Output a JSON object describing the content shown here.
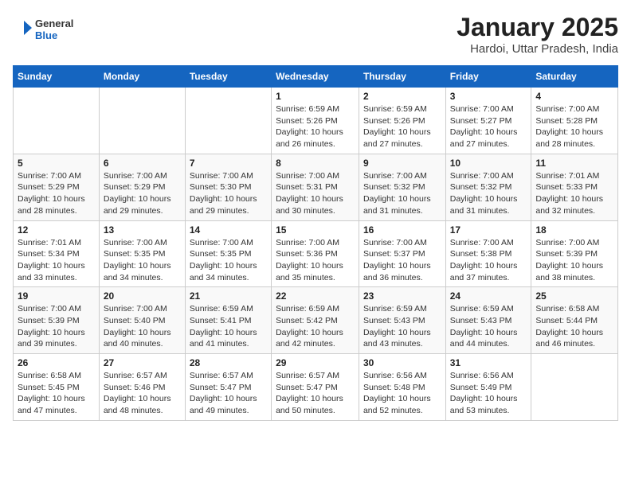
{
  "header": {
    "logo_line1": "General",
    "logo_line2": "Blue",
    "title": "January 2025",
    "subtitle": "Hardoi, Uttar Pradesh, India"
  },
  "days_of_week": [
    "Sunday",
    "Monday",
    "Tuesday",
    "Wednesday",
    "Thursday",
    "Friday",
    "Saturday"
  ],
  "weeks": [
    [
      {
        "num": "",
        "info": ""
      },
      {
        "num": "",
        "info": ""
      },
      {
        "num": "",
        "info": ""
      },
      {
        "num": "1",
        "info": "Sunrise: 6:59 AM\nSunset: 5:26 PM\nDaylight: 10 hours\nand 26 minutes."
      },
      {
        "num": "2",
        "info": "Sunrise: 6:59 AM\nSunset: 5:26 PM\nDaylight: 10 hours\nand 27 minutes."
      },
      {
        "num": "3",
        "info": "Sunrise: 7:00 AM\nSunset: 5:27 PM\nDaylight: 10 hours\nand 27 minutes."
      },
      {
        "num": "4",
        "info": "Sunrise: 7:00 AM\nSunset: 5:28 PM\nDaylight: 10 hours\nand 28 minutes."
      }
    ],
    [
      {
        "num": "5",
        "info": "Sunrise: 7:00 AM\nSunset: 5:29 PM\nDaylight: 10 hours\nand 28 minutes."
      },
      {
        "num": "6",
        "info": "Sunrise: 7:00 AM\nSunset: 5:29 PM\nDaylight: 10 hours\nand 29 minutes."
      },
      {
        "num": "7",
        "info": "Sunrise: 7:00 AM\nSunset: 5:30 PM\nDaylight: 10 hours\nand 29 minutes."
      },
      {
        "num": "8",
        "info": "Sunrise: 7:00 AM\nSunset: 5:31 PM\nDaylight: 10 hours\nand 30 minutes."
      },
      {
        "num": "9",
        "info": "Sunrise: 7:00 AM\nSunset: 5:32 PM\nDaylight: 10 hours\nand 31 minutes."
      },
      {
        "num": "10",
        "info": "Sunrise: 7:00 AM\nSunset: 5:32 PM\nDaylight: 10 hours\nand 31 minutes."
      },
      {
        "num": "11",
        "info": "Sunrise: 7:01 AM\nSunset: 5:33 PM\nDaylight: 10 hours\nand 32 minutes."
      }
    ],
    [
      {
        "num": "12",
        "info": "Sunrise: 7:01 AM\nSunset: 5:34 PM\nDaylight: 10 hours\nand 33 minutes."
      },
      {
        "num": "13",
        "info": "Sunrise: 7:00 AM\nSunset: 5:35 PM\nDaylight: 10 hours\nand 34 minutes."
      },
      {
        "num": "14",
        "info": "Sunrise: 7:00 AM\nSunset: 5:35 PM\nDaylight: 10 hours\nand 34 minutes."
      },
      {
        "num": "15",
        "info": "Sunrise: 7:00 AM\nSunset: 5:36 PM\nDaylight: 10 hours\nand 35 minutes."
      },
      {
        "num": "16",
        "info": "Sunrise: 7:00 AM\nSunset: 5:37 PM\nDaylight: 10 hours\nand 36 minutes."
      },
      {
        "num": "17",
        "info": "Sunrise: 7:00 AM\nSunset: 5:38 PM\nDaylight: 10 hours\nand 37 minutes."
      },
      {
        "num": "18",
        "info": "Sunrise: 7:00 AM\nSunset: 5:39 PM\nDaylight: 10 hours\nand 38 minutes."
      }
    ],
    [
      {
        "num": "19",
        "info": "Sunrise: 7:00 AM\nSunset: 5:39 PM\nDaylight: 10 hours\nand 39 minutes."
      },
      {
        "num": "20",
        "info": "Sunrise: 7:00 AM\nSunset: 5:40 PM\nDaylight: 10 hours\nand 40 minutes."
      },
      {
        "num": "21",
        "info": "Sunrise: 6:59 AM\nSunset: 5:41 PM\nDaylight: 10 hours\nand 41 minutes."
      },
      {
        "num": "22",
        "info": "Sunrise: 6:59 AM\nSunset: 5:42 PM\nDaylight: 10 hours\nand 42 minutes."
      },
      {
        "num": "23",
        "info": "Sunrise: 6:59 AM\nSunset: 5:43 PM\nDaylight: 10 hours\nand 43 minutes."
      },
      {
        "num": "24",
        "info": "Sunrise: 6:59 AM\nSunset: 5:43 PM\nDaylight: 10 hours\nand 44 minutes."
      },
      {
        "num": "25",
        "info": "Sunrise: 6:58 AM\nSunset: 5:44 PM\nDaylight: 10 hours\nand 46 minutes."
      }
    ],
    [
      {
        "num": "26",
        "info": "Sunrise: 6:58 AM\nSunset: 5:45 PM\nDaylight: 10 hours\nand 47 minutes."
      },
      {
        "num": "27",
        "info": "Sunrise: 6:57 AM\nSunset: 5:46 PM\nDaylight: 10 hours\nand 48 minutes."
      },
      {
        "num": "28",
        "info": "Sunrise: 6:57 AM\nSunset: 5:47 PM\nDaylight: 10 hours\nand 49 minutes."
      },
      {
        "num": "29",
        "info": "Sunrise: 6:57 AM\nSunset: 5:47 PM\nDaylight: 10 hours\nand 50 minutes."
      },
      {
        "num": "30",
        "info": "Sunrise: 6:56 AM\nSunset: 5:48 PM\nDaylight: 10 hours\nand 52 minutes."
      },
      {
        "num": "31",
        "info": "Sunrise: 6:56 AM\nSunset: 5:49 PM\nDaylight: 10 hours\nand 53 minutes."
      },
      {
        "num": "",
        "info": ""
      }
    ]
  ]
}
